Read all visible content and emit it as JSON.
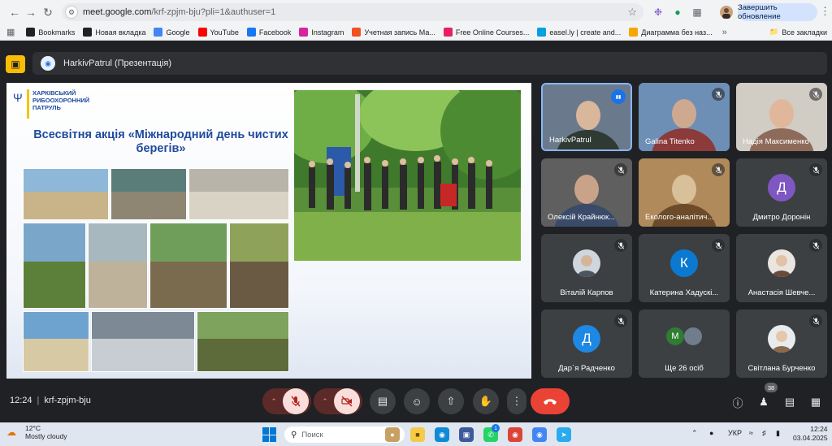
{
  "browser": {
    "url_host": "meet.google.com",
    "url_path": "/krf-zpjm-bju?pli=1&authuser=1",
    "update_button": "Завершить обновление",
    "bookmarks": [
      {
        "label": "Bookmarks",
        "icon": "star-icon",
        "color": "#202124"
      },
      {
        "label": "Новая вкладка",
        "icon": "globe-icon",
        "color": "#202124"
      },
      {
        "label": "Google",
        "icon": "google-icon",
        "color": "#4285f4"
      },
      {
        "label": "YouTube",
        "icon": "youtube-icon",
        "color": "#ff0000"
      },
      {
        "label": "Facebook",
        "icon": "facebook-icon",
        "color": "#1877f2"
      },
      {
        "label": "Instagram",
        "icon": "instagram-icon",
        "color": "#d6249f"
      },
      {
        "label": "Учетная запись Ма...",
        "icon": "microsoft-icon",
        "color": "#f25022"
      },
      {
        "label": "Free Online Courses...",
        "icon": "courses-icon",
        "color": "#e91e63"
      },
      {
        "label": "easel.ly | create and...",
        "icon": "easelly-icon",
        "color": "#00a1e0"
      },
      {
        "label": "Диаграмма без наз...",
        "icon": "diagram-icon",
        "color": "#f7a600"
      }
    ],
    "all_bookmarks": "Все закладки"
  },
  "meet": {
    "presentation_title": "HarkivPatrul (Презентація)",
    "slide": {
      "org_name": "ХАРКІВСЬКИЙ РИБООХОРОННИЙ ПАТРУЛЬ",
      "title": "Всесвітня акція «Міжнародний день чистих берегів»"
    },
    "participants": [
      {
        "name": "HarkivPatrul",
        "type": "video",
        "speaking": true
      },
      {
        "name": "Galina Titenko",
        "type": "video",
        "muted": true
      },
      {
        "name": "Надія Максименко",
        "type": "video",
        "muted": true
      },
      {
        "name": "Олексій Крайнюк...",
        "type": "video",
        "muted": true
      },
      {
        "name": "Еколого-аналітич...",
        "type": "video",
        "muted": true
      },
      {
        "name": "Дмитро Доронін",
        "type": "letter",
        "letter": "Д",
        "color": "#7e57c2",
        "muted": true
      },
      {
        "name": "Віталій Карпов",
        "type": "photo",
        "muted": true
      },
      {
        "name": "Катерина Хадускі...",
        "type": "letter",
        "letter": "К",
        "color": "#0b79d0",
        "muted": true
      },
      {
        "name": "Анастасія Шевче...",
        "type": "photo",
        "muted": true
      },
      {
        "name": "Дар`я Радченко",
        "type": "letter",
        "letter": "Д",
        "color": "#1e88e5",
        "muted": true
      },
      {
        "name": "Ще 26 осіб",
        "type": "others",
        "letter": "М",
        "color": "#2e7d32"
      },
      {
        "name": "Світлана Бурченко",
        "type": "photo",
        "muted": true
      }
    ],
    "time": "12:24",
    "meeting_code": "krf-zpjm-bju",
    "participant_count": "38"
  },
  "taskbar": {
    "temperature": "12°C",
    "weather": "Mostly cloudy",
    "search_placeholder": "Поиск",
    "language": "УКР",
    "time": "12:24",
    "date": "03.04.2025",
    "whatsapp_badge": "1"
  }
}
